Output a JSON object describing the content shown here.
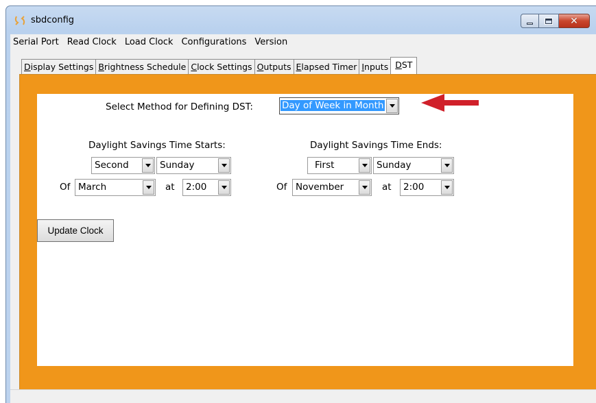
{
  "window": {
    "title": "sbdconfig",
    "app_icon": "sync-icon"
  },
  "menu": [
    "Serial Port",
    "Read Clock",
    "Load Clock",
    "Configurations",
    "Version"
  ],
  "tabs": [
    {
      "label_u": "D",
      "label_rest": "isplay Settings"
    },
    {
      "label_u": "B",
      "label_rest": "rightness Schedule"
    },
    {
      "label_u": "C",
      "label_rest": "lock Settings"
    },
    {
      "label_u": "O",
      "label_rest": "utputs"
    },
    {
      "label_u": "E",
      "label_rest": "lapsed Timer"
    },
    {
      "label_u": "I",
      "label_rest": "nputs"
    },
    {
      "label_u": "D",
      "label_rest": "ST"
    }
  ],
  "dst": {
    "method_label": "Select Method for Defining DST:",
    "method_value": "Day of Week in Month",
    "starts": {
      "heading": "Daylight Savings Time Starts:",
      "week": "Second",
      "day": "Sunday",
      "of_label": "Of",
      "month": "March",
      "at_label": "at",
      "time": "2:00"
    },
    "ends": {
      "heading": "Daylight Savings Time Ends:",
      "week": "First",
      "day": "Sunday",
      "of_label": "Of",
      "month": "November",
      "at_label": "at",
      "time": "2:00"
    },
    "update_button": "Update Clock"
  },
  "colors": {
    "orange_panel": "#f0961a",
    "annotation_arrow": "#d0202a",
    "selection": "#3399ff"
  }
}
